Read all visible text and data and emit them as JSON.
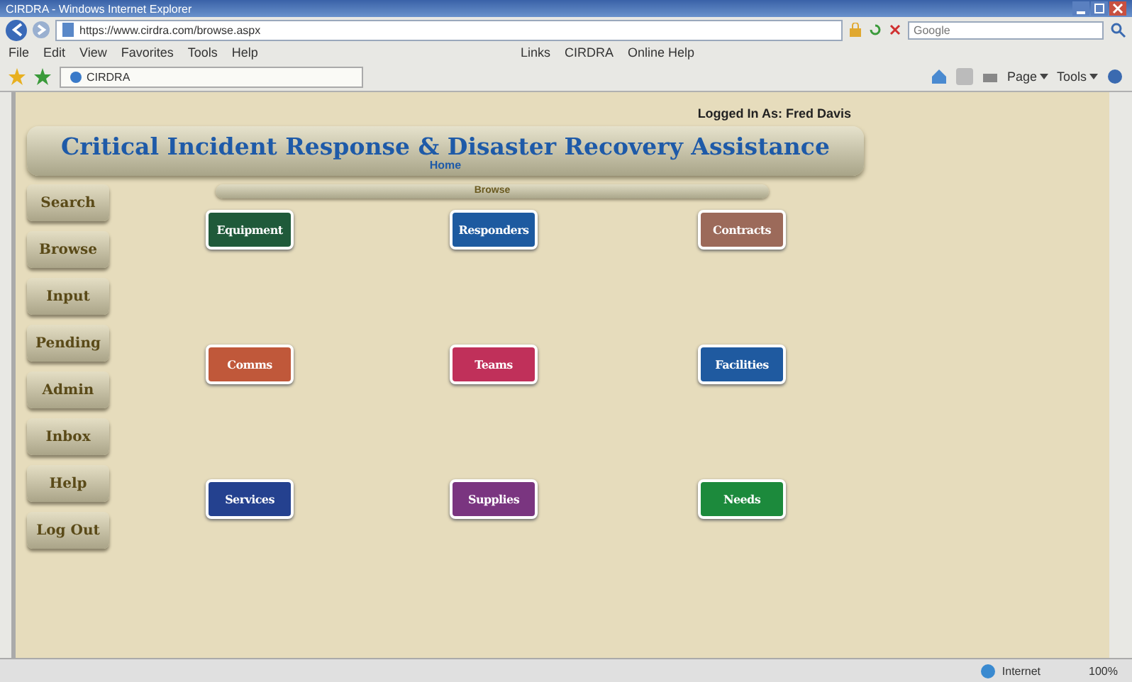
{
  "window": {
    "title": "CIRDRA - Windows Internet Explorer"
  },
  "address_bar": {
    "value": "https://www.cirdra.com/browse.aspx"
  },
  "search": {
    "placeholder": "Google"
  },
  "menu": [
    "File",
    "Edit",
    "View",
    "Favorites",
    "Tools",
    "Help"
  ],
  "links_bar": [
    "Links",
    "CIRDRA",
    "Online Help"
  ],
  "tabs": [
    {
      "label": "CIRDRA",
      "selected": true
    }
  ],
  "command_bar": [
    "Page",
    "Tools"
  ],
  "page": {
    "logged_in": "Logged In As: Fred Davis",
    "title": "Critical Incident Response & Disaster Recovery Assistance",
    "home_link": "Home",
    "section": "Browse",
    "sidebar": [
      {
        "label": "Search"
      },
      {
        "label": "Browse"
      },
      {
        "label": "Input"
      },
      {
        "label": "Pending"
      },
      {
        "label": "Admin"
      },
      {
        "label": "Inbox"
      },
      {
        "label": "Help"
      },
      {
        "label": "Log Out"
      }
    ],
    "tiles": [
      {
        "label": "Equipment",
        "color": "#1f5a3a"
      },
      {
        "label": "Responders",
        "color": "#1d5aa0"
      },
      {
        "label": "Contracts",
        "color": "#9c6a5a"
      },
      {
        "label": "Comms",
        "color": "#c0583a"
      },
      {
        "label": "Teams",
        "color": "#c0305a"
      },
      {
        "label": "Facilities",
        "color": "#1f5aa0"
      },
      {
        "label": "Services",
        "color": "#24418f"
      },
      {
        "label": "Supplies",
        "color": "#7a3580"
      },
      {
        "label": "Needs",
        "color": "#1c8a3c"
      }
    ]
  },
  "status_bar": {
    "zone": "Internet",
    "zoom": "100%"
  }
}
